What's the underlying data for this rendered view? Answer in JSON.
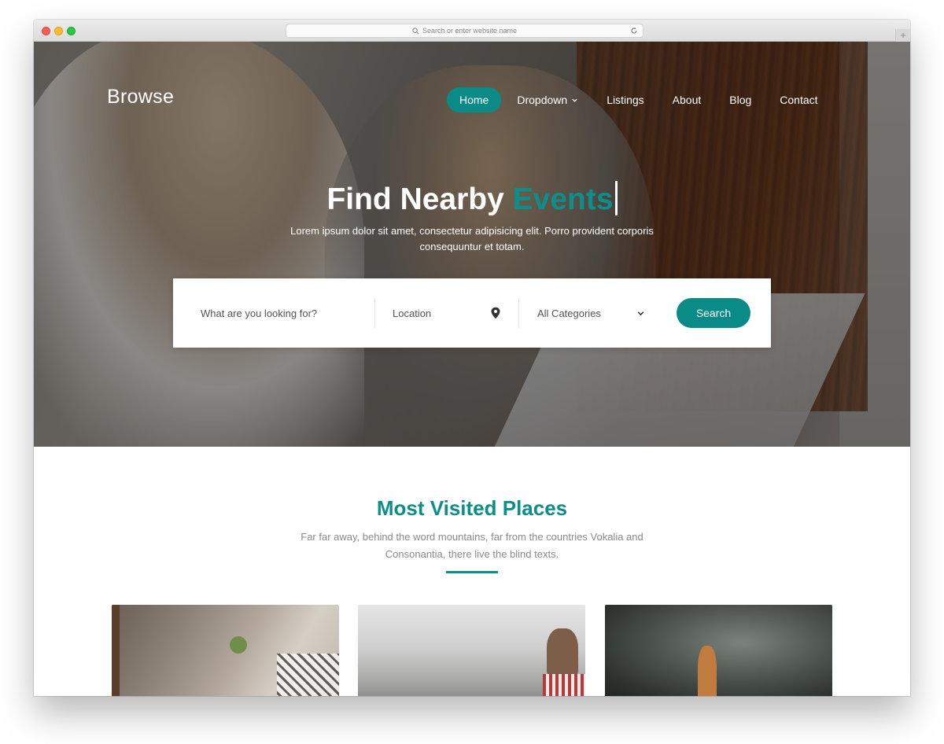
{
  "browser": {
    "url_placeholder": "Search or enter website name",
    "new_tab_symbol": "+"
  },
  "brand": "Browse",
  "nav": {
    "items": [
      {
        "label": "Home",
        "active": true
      },
      {
        "label": "Dropdown",
        "has_dropdown": true
      },
      {
        "label": "Listings"
      },
      {
        "label": "About"
      },
      {
        "label": "Blog"
      },
      {
        "label": "Contact"
      }
    ]
  },
  "hero": {
    "title_prefix": "Find Nearby",
    "title_accent": "Events",
    "subtitle": "Lorem ipsum dolor sit amet, consectetur adipisicing elit. Porro provident corporis consequuntur et totam."
  },
  "search": {
    "what_placeholder": "What are you looking for?",
    "location_placeholder": "Location",
    "category_value": "All Categories",
    "button_label": "Search"
  },
  "section": {
    "title": "Most Visited Places",
    "subtitle": "Far far away, behind the word mountains, far from the countries Vokalia and Consonantia, there live the blind texts."
  },
  "colors": {
    "accent": "#0b8b87",
    "white": "#ffffff",
    "muted_text": "#8a8a8a"
  },
  "icons": {
    "location": "map-pin-icon",
    "dropdown": "chevron-down-icon",
    "search": "magnifier-icon",
    "reload": "reload-icon"
  }
}
